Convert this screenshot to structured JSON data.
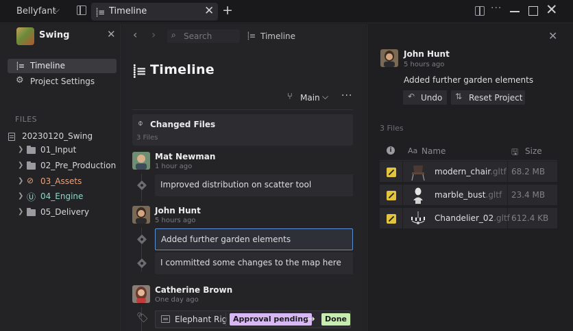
{
  "titlebar": {
    "app_name": "Bellyfant",
    "tab_label": "Timeline"
  },
  "sidebar": {
    "project_name": "Swing",
    "nav": [
      {
        "label": "Timeline",
        "icon": "timeline-icon",
        "active": true
      },
      {
        "label": "Project Settings",
        "icon": "gear-icon",
        "active": false
      }
    ],
    "files_heading": "FILES",
    "root": "20230120_Swing",
    "folders": [
      {
        "label": "01_Input",
        "color": "#d8d8da"
      },
      {
        "label": "02_Pre_Production",
        "color": "#d8d8da"
      },
      {
        "label": "03_Assets",
        "color": "#e9a27d"
      },
      {
        "label": "04_Engine",
        "color": "#8fd8c8"
      },
      {
        "label": "05_Delivery",
        "color": "#d8d8da"
      }
    ]
  },
  "main": {
    "search_placeholder": "Search",
    "breadcrumb": "Timeline",
    "title": "Timeline",
    "branch": "Main",
    "changed_files": {
      "title": "Changed Files",
      "count": "3 Files"
    },
    "entries": [
      {
        "author": "Mat Newman",
        "time": "1 hour ago",
        "commits": [
          "Improved distribution on scatter tool"
        ]
      },
      {
        "author": "John Hunt",
        "time": "5 hours ago",
        "commits": [
          "Added further garden elements",
          "I committed some changes to the map here"
        ]
      },
      {
        "author": "Catherine Brown",
        "time": "One day ago",
        "task": {
          "label": "Elephant Rig",
          "from": "Approval pending",
          "to": "Done"
        }
      }
    ]
  },
  "detail": {
    "author": "John Hunt",
    "time": "5 hours ago",
    "message": "Added further garden elements",
    "undo_label": "Undo",
    "reset_label": "Reset Project",
    "files_count": "3 Files",
    "columns": {
      "name": "Name",
      "size": "Size"
    },
    "files": [
      {
        "name": "modern_chair",
        "ext": ".gltf",
        "size": "68.2 MB"
      },
      {
        "name": "marble_bust",
        "ext": ".gltf",
        "size": "23.4 MB"
      },
      {
        "name": "Chandelier_02",
        "ext": ".gltf",
        "size": "612.4 KB"
      }
    ]
  },
  "colors": {
    "accent_blue": "#5b8fd6",
    "status_pending": "#d8b8f4",
    "status_done": "#c6ecb0",
    "edit_yellow": "#e3c43d"
  }
}
